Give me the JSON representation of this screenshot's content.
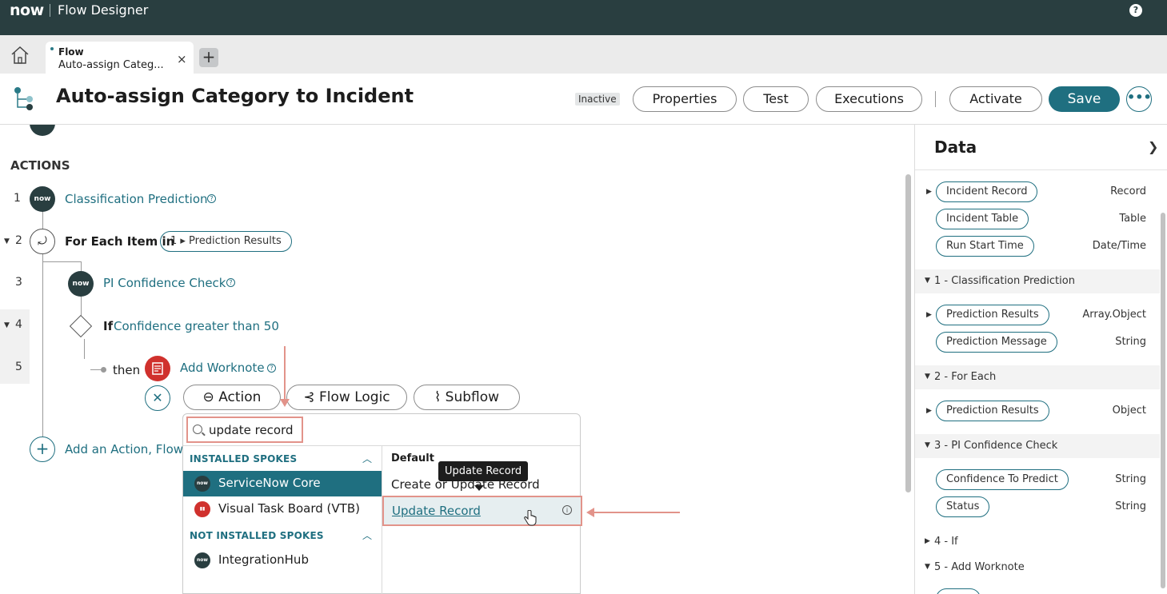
{
  "topbar": {
    "logo": "now",
    "app_title": "Flow Designer",
    "help": "?"
  },
  "tabs": {
    "active": {
      "kind": "Flow",
      "name": "Auto-assign Categ...",
      "close": "×"
    },
    "add": "+"
  },
  "header": {
    "title": "Auto-assign Category to Incident",
    "status": "Inactive",
    "buttons": {
      "properties": "Properties",
      "test": "Test",
      "executions": "Executions",
      "activate": "Activate",
      "save": "Save",
      "more": "•••"
    }
  },
  "canvas": {
    "actions_heading": "ACTIONS",
    "steps": [
      {
        "num": "1",
        "label": "Classification Prediction"
      },
      {
        "num": "2",
        "label": "For Each Item in",
        "chip": "1 ▸ Prediction Results"
      },
      {
        "num": "3",
        "label": "PI Confidence Check"
      },
      {
        "num": "4",
        "keyword": "If",
        "label": "Confidence greater than 50"
      },
      {
        "num": "5",
        "keyword": "then",
        "label": "Add Worknote"
      }
    ],
    "now_badge": "now",
    "type_buttons": {
      "action": "Action",
      "flow_logic": "Flow Logic",
      "subflow": "Subflow"
    },
    "add_label": "Add an Action, Flow L"
  },
  "popup": {
    "search_value": "update record",
    "installed_heading": "INSTALLED SPOKES",
    "not_installed_heading": "NOT INSTALLED SPOKES",
    "installed": [
      "ServiceNow Core",
      "Visual Task Board (VTB)"
    ],
    "not_installed": [
      "IntegrationHub"
    ],
    "default_heading": "Default",
    "create_item": "Create or Update Record",
    "update_item": "Update Record",
    "tooltip": "Update Record"
  },
  "data_panel": {
    "title": "Data",
    "trigger_fields": [
      {
        "label": "Incident Record",
        "type": "Record",
        "expandable": true
      },
      {
        "label": "Incident Table",
        "type": "Table"
      },
      {
        "label": "Run Start Time",
        "type": "Date/Time"
      }
    ],
    "groups": [
      {
        "label": "1 - Classification Prediction",
        "fields": [
          {
            "label": "Prediction Results",
            "type": "Array.Object",
            "expandable": true
          },
          {
            "label": "Prediction Message",
            "type": "String"
          }
        ]
      },
      {
        "label": "2 - For Each",
        "fields": [
          {
            "label": "Prediction Results",
            "type": "Object",
            "expandable": true
          }
        ]
      },
      {
        "label": "3 - PI Confidence Check",
        "fields": [
          {
            "label": "Confidence To Predict",
            "type": "String"
          },
          {
            "label": "Status",
            "type": "String"
          }
        ]
      },
      {
        "label": "4 - If"
      },
      {
        "label": "5 - Add Worknote"
      }
    ]
  },
  "colors": {
    "topbar": "#293e40",
    "accent": "#1f6f80",
    "highlight": "#e2938a",
    "error": "#d0312d"
  }
}
